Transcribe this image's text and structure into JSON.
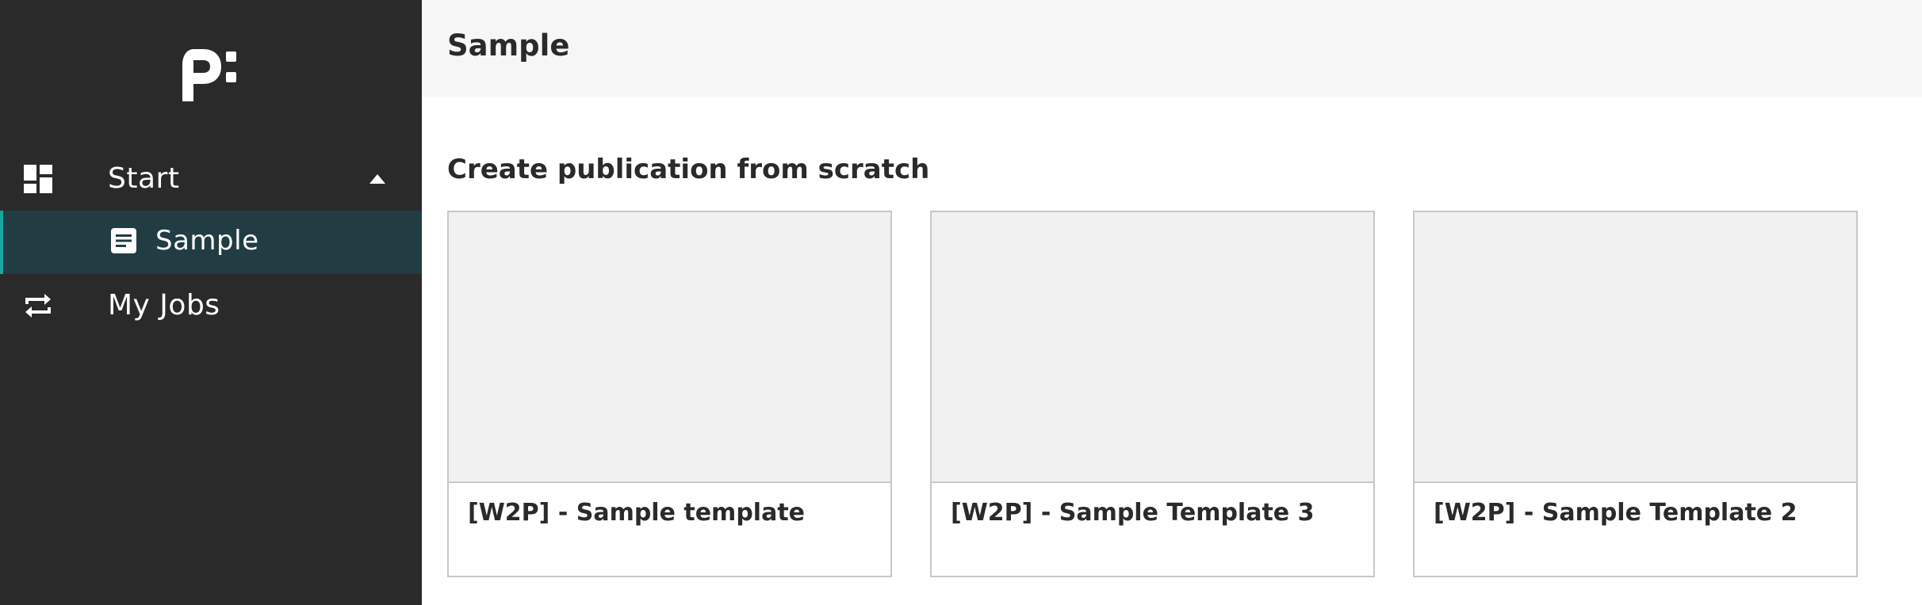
{
  "header": {
    "title": "Sample"
  },
  "sidebar": {
    "logo": "logo",
    "items": [
      {
        "label": "Start",
        "icon": "dashboard-icon",
        "expanded": true
      },
      {
        "label": "Sample",
        "icon": "document-icon",
        "active": true
      },
      {
        "label": "My Jobs",
        "icon": "repeat-icon"
      }
    ]
  },
  "main": {
    "section_title": "Create publication from scratch",
    "templates": [
      {
        "label": "[W2P] - Sample template"
      },
      {
        "label": "[W2P] - Sample Template 3"
      },
      {
        "label": "[W2P] - Sample Template 2"
      }
    ]
  },
  "colors": {
    "sidebar_bg": "#2a2a2a",
    "active_bg": "#213c43",
    "active_accent": "#1aa6a0",
    "topbar_bg": "#f6f6f6",
    "card_border": "#c8c8c8",
    "thumb_bg": "#f1f1f1"
  }
}
